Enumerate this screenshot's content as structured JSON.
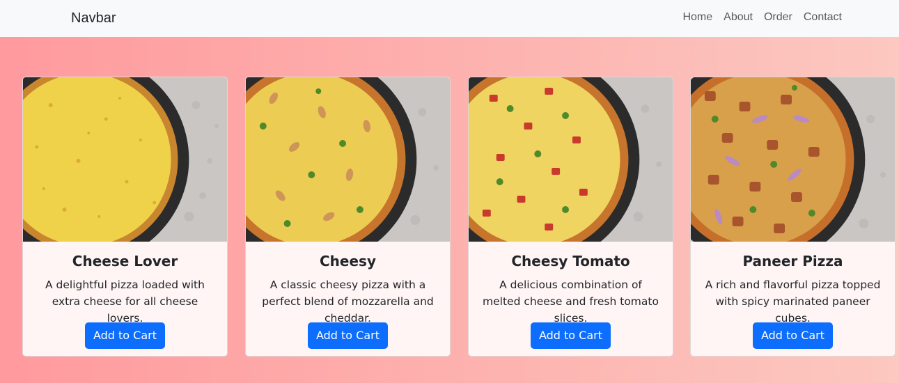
{
  "navbar": {
    "brand": "Navbar",
    "links": [
      "Home",
      "About",
      "Order",
      "Contact"
    ]
  },
  "cards": [
    {
      "title": "Cheese Lover",
      "text": "A delightful pizza loaded with extra cheese for all cheese lovers.",
      "button": "Add to Cart"
    },
    {
      "title": "Cheesy",
      "text": "A classic cheesy pizza with a perfect blend of mozzarella and cheddar.",
      "button": "Add to Cart"
    },
    {
      "title": "Cheesy Tomato",
      "text": "A delicious combination of melted cheese and fresh tomato slices.",
      "button": "Add to Cart"
    },
    {
      "title": "Paneer Pizza",
      "text": "A rich and flavorful pizza topped with spicy marinated paneer cubes.",
      "button": "Add to Cart"
    }
  ],
  "colors": {
    "primary": "#0d6efd",
    "navbar_bg": "#f8f9fa",
    "card_bg": "#fff5f5"
  }
}
